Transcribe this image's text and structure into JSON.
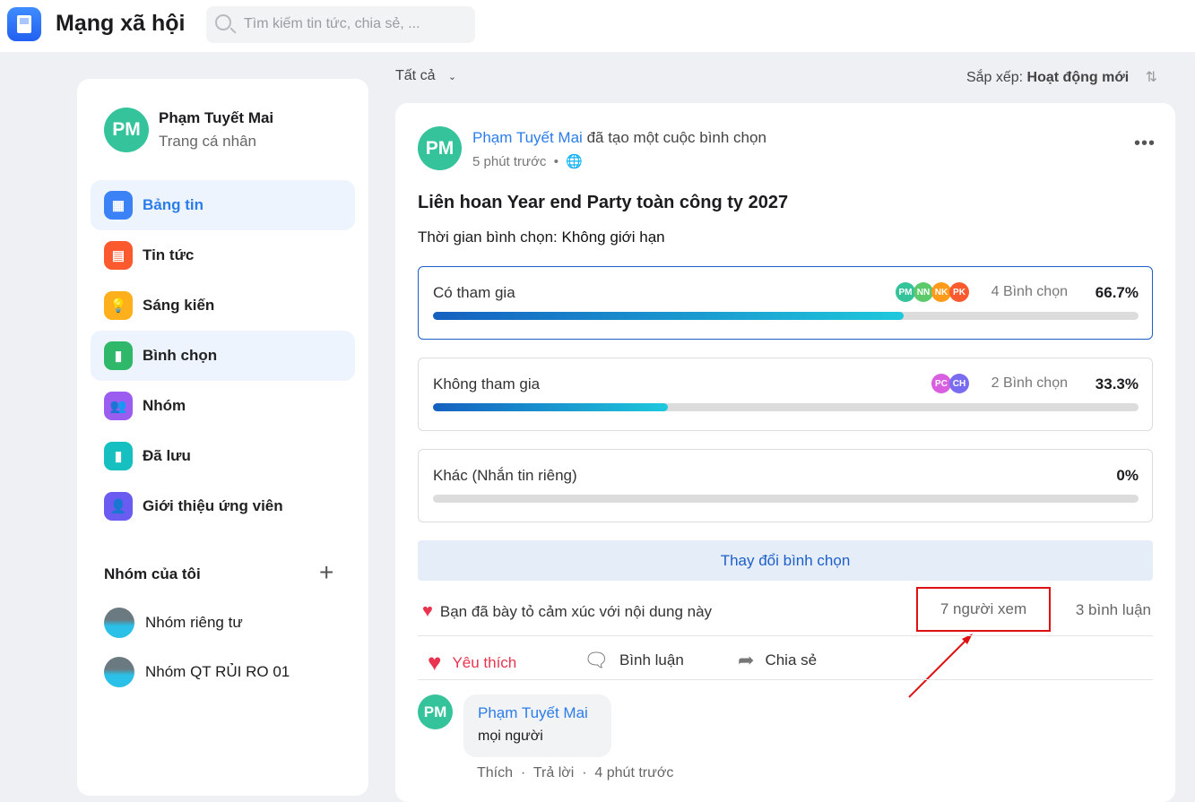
{
  "header": {
    "title": "Mạng xã hội",
    "search_placeholder": "Tìm kiếm tin tức, chia sẻ, ..."
  },
  "filter": {
    "label": "Tất cả",
    "sort_label": "Sắp xếp:",
    "sort_value": "Hoạt động mới"
  },
  "profile": {
    "initials": "PM",
    "name": "Phạm Tuyết Mai",
    "sub": "Trang cá nhân"
  },
  "nav": [
    {
      "label": "Bảng tin",
      "icon": "newsfeed-icon",
      "color": "#3b82f6",
      "active": true
    },
    {
      "label": "Tin tức",
      "icon": "news-icon",
      "color": "#fa5a2e"
    },
    {
      "label": "Sáng kiến",
      "icon": "lightbulb-icon",
      "color": "#fdb01c"
    },
    {
      "label": "Bình chọn",
      "icon": "poll-chart-icon",
      "color": "#2fb86a",
      "active": true
    },
    {
      "label": "Nhóm",
      "icon": "group-icon",
      "color": "#9b5cf0"
    },
    {
      "label": "Đã lưu",
      "icon": "bookmark-icon",
      "color": "#16c0c0"
    },
    {
      "label": "Giới thiệu ứng viên",
      "icon": "user-add-icon",
      "color": "#6a5cf0"
    }
  ],
  "groups": {
    "title": "Nhóm của tôi",
    "items": [
      "Nhóm riêng tư",
      "Nhóm QT RỦI RO 01"
    ]
  },
  "post": {
    "author": "Phạm Tuyết Mai",
    "action": "đã tạo một cuộc bình chọn",
    "time": "5 phút trước",
    "title": "Liên hoan Year end Party toàn công ty 2027",
    "deadline_label": "Thời gian bình chọn:",
    "deadline_value": "Không giới hạn",
    "options": [
      {
        "label": "Có tham gia",
        "count": "4 Bình chọn",
        "percent": "66.7%",
        "value": 66.7,
        "voters": [
          [
            "PM",
            "#34c39a"
          ],
          [
            "NN",
            "#5cc96a"
          ],
          [
            "NK",
            "#ff9a1a"
          ],
          [
            "PK",
            "#fa5a2e"
          ]
        ]
      },
      {
        "label": "Không tham gia",
        "count": "2 Bình chọn",
        "percent": "33.3%",
        "value": 33.3,
        "voters": [
          [
            "PC",
            "#d860e0"
          ],
          [
            "CH",
            "#7a6cf0"
          ]
        ]
      },
      {
        "label": "Khác (Nhắn tin riêng)",
        "count": "",
        "percent": "0%",
        "value": 0,
        "voters": []
      }
    ],
    "change_vote": "Thay đổi bình chọn",
    "reaction_text": "Bạn đã bày tỏ cảm xúc với nội dung này",
    "views": "7 người xem",
    "comments": "3 bình luận",
    "actions": {
      "like": "Yêu thích",
      "comment": "Bình luận",
      "share": "Chia sẻ"
    },
    "comment": {
      "initials": "PM",
      "author": "Phạm Tuyết Mai",
      "text": "mọi người",
      "like": "Thích",
      "reply": "Trả lời",
      "time": "4 phút trước"
    }
  }
}
